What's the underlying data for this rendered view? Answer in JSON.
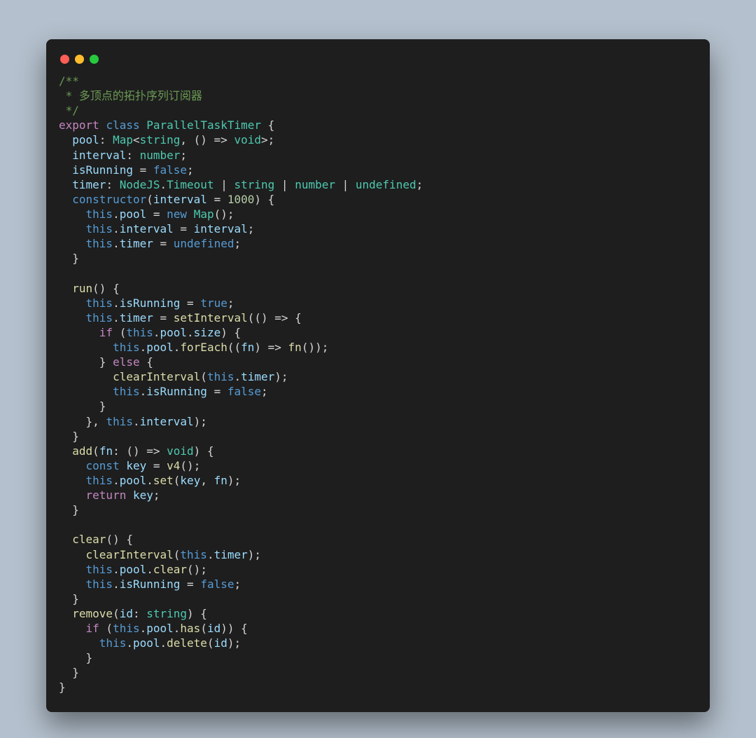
{
  "code": {
    "tokens": [
      [
        [
          "c-comment",
          "/**"
        ]
      ],
      [
        [
          "c-comment",
          " * 多顶点的拓扑序列订阅器"
        ]
      ],
      [
        [
          "c-comment",
          " */"
        ]
      ],
      [
        [
          "c-keyword",
          "export"
        ],
        [
          "c-punc",
          " "
        ],
        [
          "c-storage",
          "class"
        ],
        [
          "c-punc",
          " "
        ],
        [
          "c-type",
          "ParallelTaskTimer"
        ],
        [
          "c-punc",
          " {"
        ]
      ],
      [
        [
          "c-punc",
          "  "
        ],
        [
          "c-var",
          "pool"
        ],
        [
          "c-punc",
          ": "
        ],
        [
          "c-type",
          "Map"
        ],
        [
          "c-punc",
          "<"
        ],
        [
          "c-type",
          "string"
        ],
        [
          "c-punc",
          ", () => "
        ],
        [
          "c-type",
          "void"
        ],
        [
          "c-punc",
          ">;"
        ]
      ],
      [
        [
          "c-punc",
          "  "
        ],
        [
          "c-var",
          "interval"
        ],
        [
          "c-punc",
          ": "
        ],
        [
          "c-type",
          "number"
        ],
        [
          "c-punc",
          ";"
        ]
      ],
      [
        [
          "c-punc",
          "  "
        ],
        [
          "c-var",
          "isRunning"
        ],
        [
          "c-punc",
          " = "
        ],
        [
          "c-storage",
          "false"
        ],
        [
          "c-punc",
          ";"
        ]
      ],
      [
        [
          "c-punc",
          "  "
        ],
        [
          "c-var",
          "timer"
        ],
        [
          "c-punc",
          ": "
        ],
        [
          "c-type",
          "NodeJS"
        ],
        [
          "c-punc",
          "."
        ],
        [
          "c-type",
          "Timeout"
        ],
        [
          "c-punc",
          " | "
        ],
        [
          "c-type",
          "string"
        ],
        [
          "c-punc",
          " | "
        ],
        [
          "c-type",
          "number"
        ],
        [
          "c-punc",
          " | "
        ],
        [
          "c-type",
          "undefined"
        ],
        [
          "c-punc",
          ";"
        ]
      ],
      [
        [
          "c-punc",
          "  "
        ],
        [
          "c-storage",
          "constructor"
        ],
        [
          "c-punc",
          "("
        ],
        [
          "c-var",
          "interval"
        ],
        [
          "c-punc",
          " = "
        ],
        [
          "c-num",
          "1000"
        ],
        [
          "c-punc",
          ") {"
        ]
      ],
      [
        [
          "c-punc",
          "    "
        ],
        [
          "c-storage",
          "this"
        ],
        [
          "c-punc",
          "."
        ],
        [
          "c-var",
          "pool"
        ],
        [
          "c-punc",
          " = "
        ],
        [
          "c-storage",
          "new"
        ],
        [
          "c-punc",
          " "
        ],
        [
          "c-type",
          "Map"
        ],
        [
          "c-punc",
          "();"
        ]
      ],
      [
        [
          "c-punc",
          "    "
        ],
        [
          "c-storage",
          "this"
        ],
        [
          "c-punc",
          "."
        ],
        [
          "c-var",
          "interval"
        ],
        [
          "c-punc",
          " = "
        ],
        [
          "c-var",
          "interval"
        ],
        [
          "c-punc",
          ";"
        ]
      ],
      [
        [
          "c-punc",
          "    "
        ],
        [
          "c-storage",
          "this"
        ],
        [
          "c-punc",
          "."
        ],
        [
          "c-var",
          "timer"
        ],
        [
          "c-punc",
          " = "
        ],
        [
          "c-storage",
          "undefined"
        ],
        [
          "c-punc",
          ";"
        ]
      ],
      [
        [
          "c-punc",
          "  }"
        ]
      ],
      [
        [
          "c-punc",
          ""
        ]
      ],
      [
        [
          "c-punc",
          "  "
        ],
        [
          "c-func",
          "run"
        ],
        [
          "c-punc",
          "() {"
        ]
      ],
      [
        [
          "c-punc",
          "    "
        ],
        [
          "c-storage",
          "this"
        ],
        [
          "c-punc",
          "."
        ],
        [
          "c-var",
          "isRunning"
        ],
        [
          "c-punc",
          " = "
        ],
        [
          "c-storage",
          "true"
        ],
        [
          "c-punc",
          ";"
        ]
      ],
      [
        [
          "c-punc",
          "    "
        ],
        [
          "c-storage",
          "this"
        ],
        [
          "c-punc",
          "."
        ],
        [
          "c-var",
          "timer"
        ],
        [
          "c-punc",
          " = "
        ],
        [
          "c-func",
          "setInterval"
        ],
        [
          "c-punc",
          "(() => {"
        ]
      ],
      [
        [
          "c-punc",
          "      "
        ],
        [
          "c-keyword",
          "if"
        ],
        [
          "c-punc",
          " ("
        ],
        [
          "c-storage",
          "this"
        ],
        [
          "c-punc",
          "."
        ],
        [
          "c-var",
          "pool"
        ],
        [
          "c-punc",
          "."
        ],
        [
          "c-var",
          "size"
        ],
        [
          "c-punc",
          ") {"
        ]
      ],
      [
        [
          "c-punc",
          "        "
        ],
        [
          "c-storage",
          "this"
        ],
        [
          "c-punc",
          "."
        ],
        [
          "c-var",
          "pool"
        ],
        [
          "c-punc",
          "."
        ],
        [
          "c-func",
          "forEach"
        ],
        [
          "c-punc",
          "(("
        ],
        [
          "c-var",
          "fn"
        ],
        [
          "c-punc",
          ") => "
        ],
        [
          "c-func",
          "fn"
        ],
        [
          "c-punc",
          "());"
        ]
      ],
      [
        [
          "c-punc",
          "      } "
        ],
        [
          "c-keyword",
          "else"
        ],
        [
          "c-punc",
          " {"
        ]
      ],
      [
        [
          "c-punc",
          "        "
        ],
        [
          "c-func",
          "clearInterval"
        ],
        [
          "c-punc",
          "("
        ],
        [
          "c-storage",
          "this"
        ],
        [
          "c-punc",
          "."
        ],
        [
          "c-var",
          "timer"
        ],
        [
          "c-punc",
          ");"
        ]
      ],
      [
        [
          "c-punc",
          "        "
        ],
        [
          "c-storage",
          "this"
        ],
        [
          "c-punc",
          "."
        ],
        [
          "c-var",
          "isRunning"
        ],
        [
          "c-punc",
          " = "
        ],
        [
          "c-storage",
          "false"
        ],
        [
          "c-punc",
          ";"
        ]
      ],
      [
        [
          "c-punc",
          "      }"
        ]
      ],
      [
        [
          "c-punc",
          "    }, "
        ],
        [
          "c-storage",
          "this"
        ],
        [
          "c-punc",
          "."
        ],
        [
          "c-var",
          "interval"
        ],
        [
          "c-punc",
          ");"
        ]
      ],
      [
        [
          "c-punc",
          "  }"
        ]
      ],
      [
        [
          "c-punc",
          "  "
        ],
        [
          "c-func",
          "add"
        ],
        [
          "c-punc",
          "("
        ],
        [
          "c-var",
          "fn"
        ],
        [
          "c-punc",
          ": () => "
        ],
        [
          "c-type",
          "void"
        ],
        [
          "c-punc",
          ") {"
        ]
      ],
      [
        [
          "c-punc",
          "    "
        ],
        [
          "c-storage",
          "const"
        ],
        [
          "c-punc",
          " "
        ],
        [
          "c-var",
          "key"
        ],
        [
          "c-punc",
          " = "
        ],
        [
          "c-func",
          "v4"
        ],
        [
          "c-punc",
          "();"
        ]
      ],
      [
        [
          "c-punc",
          "    "
        ],
        [
          "c-storage",
          "this"
        ],
        [
          "c-punc",
          "."
        ],
        [
          "c-var",
          "pool"
        ],
        [
          "c-punc",
          "."
        ],
        [
          "c-func",
          "set"
        ],
        [
          "c-punc",
          "("
        ],
        [
          "c-var",
          "key"
        ],
        [
          "c-punc",
          ", "
        ],
        [
          "c-var",
          "fn"
        ],
        [
          "c-punc",
          ");"
        ]
      ],
      [
        [
          "c-punc",
          "    "
        ],
        [
          "c-keyword",
          "return"
        ],
        [
          "c-punc",
          " "
        ],
        [
          "c-var",
          "key"
        ],
        [
          "c-punc",
          ";"
        ]
      ],
      [
        [
          "c-punc",
          "  }"
        ]
      ],
      [
        [
          "c-punc",
          ""
        ]
      ],
      [
        [
          "c-punc",
          "  "
        ],
        [
          "c-func",
          "clear"
        ],
        [
          "c-punc",
          "() {"
        ]
      ],
      [
        [
          "c-punc",
          "    "
        ],
        [
          "c-func",
          "clearInterval"
        ],
        [
          "c-punc",
          "("
        ],
        [
          "c-storage",
          "this"
        ],
        [
          "c-punc",
          "."
        ],
        [
          "c-var",
          "timer"
        ],
        [
          "c-punc",
          ");"
        ]
      ],
      [
        [
          "c-punc",
          "    "
        ],
        [
          "c-storage",
          "this"
        ],
        [
          "c-punc",
          "."
        ],
        [
          "c-var",
          "pool"
        ],
        [
          "c-punc",
          "."
        ],
        [
          "c-func",
          "clear"
        ],
        [
          "c-punc",
          "();"
        ]
      ],
      [
        [
          "c-punc",
          "    "
        ],
        [
          "c-storage",
          "this"
        ],
        [
          "c-punc",
          "."
        ],
        [
          "c-var",
          "isRunning"
        ],
        [
          "c-punc",
          " = "
        ],
        [
          "c-storage",
          "false"
        ],
        [
          "c-punc",
          ";"
        ]
      ],
      [
        [
          "c-punc",
          "  }"
        ]
      ],
      [
        [
          "c-punc",
          "  "
        ],
        [
          "c-func",
          "remove"
        ],
        [
          "c-punc",
          "("
        ],
        [
          "c-var",
          "id"
        ],
        [
          "c-punc",
          ": "
        ],
        [
          "c-type",
          "string"
        ],
        [
          "c-punc",
          ") {"
        ]
      ],
      [
        [
          "c-punc",
          "    "
        ],
        [
          "c-keyword",
          "if"
        ],
        [
          "c-punc",
          " ("
        ],
        [
          "c-storage",
          "this"
        ],
        [
          "c-punc",
          "."
        ],
        [
          "c-var",
          "pool"
        ],
        [
          "c-punc",
          "."
        ],
        [
          "c-func",
          "has"
        ],
        [
          "c-punc",
          "("
        ],
        [
          "c-var",
          "id"
        ],
        [
          "c-punc",
          ")) {"
        ]
      ],
      [
        [
          "c-punc",
          "      "
        ],
        [
          "c-storage",
          "this"
        ],
        [
          "c-punc",
          "."
        ],
        [
          "c-var",
          "pool"
        ],
        [
          "c-punc",
          "."
        ],
        [
          "c-func",
          "delete"
        ],
        [
          "c-punc",
          "("
        ],
        [
          "c-var",
          "id"
        ],
        [
          "c-punc",
          ");"
        ]
      ],
      [
        [
          "c-punc",
          "    }"
        ]
      ],
      [
        [
          "c-punc",
          "  }"
        ]
      ],
      [
        [
          "c-punc",
          "}"
        ]
      ]
    ]
  }
}
